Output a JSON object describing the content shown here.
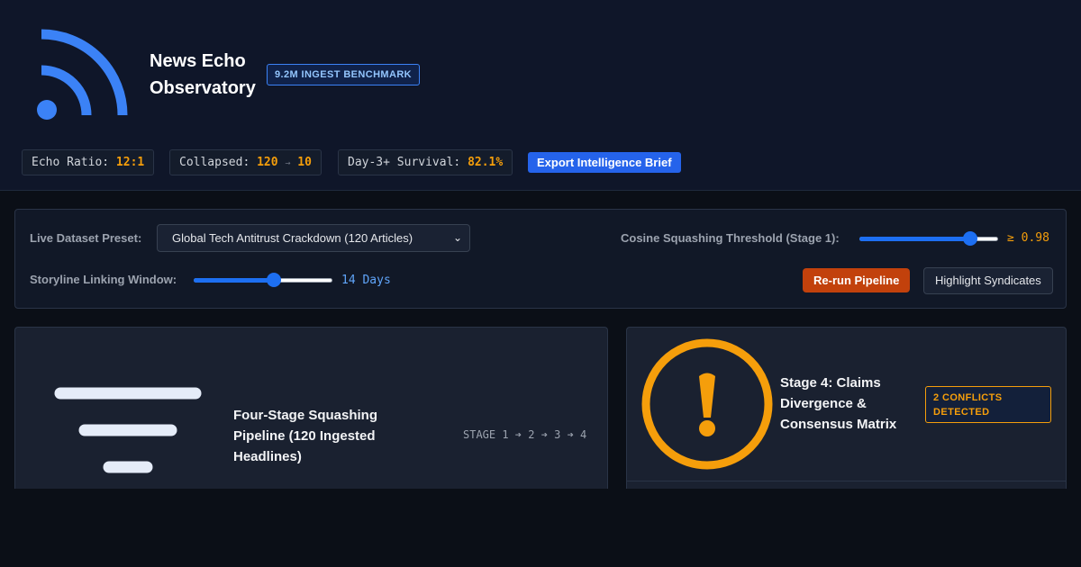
{
  "app": {
    "title": "News Echo Observatory",
    "benchmark_badge": "9.2M INGEST BENCHMARK",
    "logo_icon": "rss-icon"
  },
  "stats": {
    "echo_ratio": {
      "label": "Echo Ratio:",
      "value": "12:1"
    },
    "collapsed": {
      "label": "Collapsed:",
      "from": "120",
      "arrow": "→",
      "to": "10"
    },
    "survival": {
      "label": "Day-3+ Survival:",
      "value": "82.1%"
    }
  },
  "toolbar": {
    "export_label": "Export Intelligence Brief"
  },
  "controls": {
    "preset_label": "Live Dataset Preset:",
    "preset_value": "Global Tech Antitrust Crackdown (120 Articles)",
    "cosine_label": "Cosine Squashing Threshold (Stage 1):",
    "cosine_value": "≥ 0.98",
    "cosine_fraction": 0.8,
    "window_label": "Storyline Linking Window:",
    "window_value": "14 Days",
    "window_fraction": 0.58,
    "rerun_label": "Re-run Pipeline",
    "highlight_label": "Highlight Syndicates"
  },
  "cards": {
    "pipeline": {
      "title": "Four-Stage Squashing Pipeline (120 Ingested Headlines)",
      "stage_flow": "STAGE 1 ➔ 2 ➔ 3 ➔ 4",
      "icon": "funnel-icon"
    },
    "divergence": {
      "title": "Stage 4: Claims Divergence & Consensus Matrix",
      "badge": "2 CONFLICTS DETECTED",
      "icon": "warning-icon"
    }
  },
  "colors": {
    "accent_blue": "#3b82f6",
    "accent_amber": "#f59e0b",
    "rerun_orange": "#c2410c",
    "header_bg": "#0f1629"
  }
}
